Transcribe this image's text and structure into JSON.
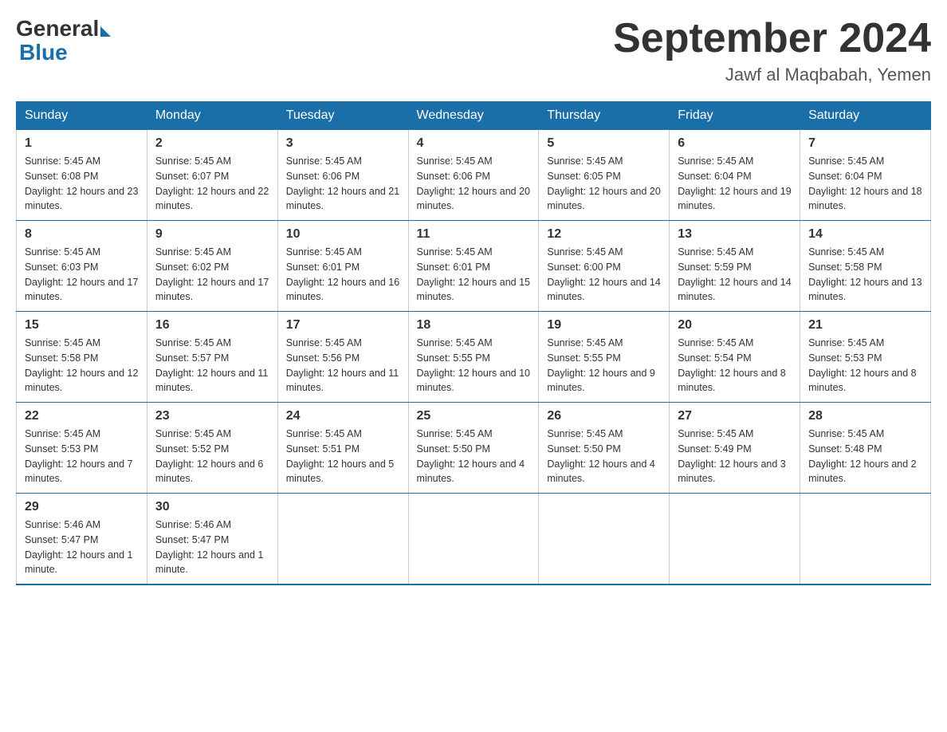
{
  "header": {
    "logo_general": "General",
    "logo_blue": "Blue",
    "month_title": "September 2024",
    "location": "Jawf al Maqbabah, Yemen"
  },
  "weekdays": [
    "Sunday",
    "Monday",
    "Tuesday",
    "Wednesday",
    "Thursday",
    "Friday",
    "Saturday"
  ],
  "weeks": [
    [
      {
        "day": "1",
        "sunrise": "5:45 AM",
        "sunset": "6:08 PM",
        "daylight": "12 hours and 23 minutes."
      },
      {
        "day": "2",
        "sunrise": "5:45 AM",
        "sunset": "6:07 PM",
        "daylight": "12 hours and 22 minutes."
      },
      {
        "day": "3",
        "sunrise": "5:45 AM",
        "sunset": "6:06 PM",
        "daylight": "12 hours and 21 minutes."
      },
      {
        "day": "4",
        "sunrise": "5:45 AM",
        "sunset": "6:06 PM",
        "daylight": "12 hours and 20 minutes."
      },
      {
        "day": "5",
        "sunrise": "5:45 AM",
        "sunset": "6:05 PM",
        "daylight": "12 hours and 20 minutes."
      },
      {
        "day": "6",
        "sunrise": "5:45 AM",
        "sunset": "6:04 PM",
        "daylight": "12 hours and 19 minutes."
      },
      {
        "day": "7",
        "sunrise": "5:45 AM",
        "sunset": "6:04 PM",
        "daylight": "12 hours and 18 minutes."
      }
    ],
    [
      {
        "day": "8",
        "sunrise": "5:45 AM",
        "sunset": "6:03 PM",
        "daylight": "12 hours and 17 minutes."
      },
      {
        "day": "9",
        "sunrise": "5:45 AM",
        "sunset": "6:02 PM",
        "daylight": "12 hours and 17 minutes."
      },
      {
        "day": "10",
        "sunrise": "5:45 AM",
        "sunset": "6:01 PM",
        "daylight": "12 hours and 16 minutes."
      },
      {
        "day": "11",
        "sunrise": "5:45 AM",
        "sunset": "6:01 PM",
        "daylight": "12 hours and 15 minutes."
      },
      {
        "day": "12",
        "sunrise": "5:45 AM",
        "sunset": "6:00 PM",
        "daylight": "12 hours and 14 minutes."
      },
      {
        "day": "13",
        "sunrise": "5:45 AM",
        "sunset": "5:59 PM",
        "daylight": "12 hours and 14 minutes."
      },
      {
        "day": "14",
        "sunrise": "5:45 AM",
        "sunset": "5:58 PM",
        "daylight": "12 hours and 13 minutes."
      }
    ],
    [
      {
        "day": "15",
        "sunrise": "5:45 AM",
        "sunset": "5:58 PM",
        "daylight": "12 hours and 12 minutes."
      },
      {
        "day": "16",
        "sunrise": "5:45 AM",
        "sunset": "5:57 PM",
        "daylight": "12 hours and 11 minutes."
      },
      {
        "day": "17",
        "sunrise": "5:45 AM",
        "sunset": "5:56 PM",
        "daylight": "12 hours and 11 minutes."
      },
      {
        "day": "18",
        "sunrise": "5:45 AM",
        "sunset": "5:55 PM",
        "daylight": "12 hours and 10 minutes."
      },
      {
        "day": "19",
        "sunrise": "5:45 AM",
        "sunset": "5:55 PM",
        "daylight": "12 hours and 9 minutes."
      },
      {
        "day": "20",
        "sunrise": "5:45 AM",
        "sunset": "5:54 PM",
        "daylight": "12 hours and 8 minutes."
      },
      {
        "day": "21",
        "sunrise": "5:45 AM",
        "sunset": "5:53 PM",
        "daylight": "12 hours and 8 minutes."
      }
    ],
    [
      {
        "day": "22",
        "sunrise": "5:45 AM",
        "sunset": "5:53 PM",
        "daylight": "12 hours and 7 minutes."
      },
      {
        "day": "23",
        "sunrise": "5:45 AM",
        "sunset": "5:52 PM",
        "daylight": "12 hours and 6 minutes."
      },
      {
        "day": "24",
        "sunrise": "5:45 AM",
        "sunset": "5:51 PM",
        "daylight": "12 hours and 5 minutes."
      },
      {
        "day": "25",
        "sunrise": "5:45 AM",
        "sunset": "5:50 PM",
        "daylight": "12 hours and 4 minutes."
      },
      {
        "day": "26",
        "sunrise": "5:45 AM",
        "sunset": "5:50 PM",
        "daylight": "12 hours and 4 minutes."
      },
      {
        "day": "27",
        "sunrise": "5:45 AM",
        "sunset": "5:49 PM",
        "daylight": "12 hours and 3 minutes."
      },
      {
        "day": "28",
        "sunrise": "5:45 AM",
        "sunset": "5:48 PM",
        "daylight": "12 hours and 2 minutes."
      }
    ],
    [
      {
        "day": "29",
        "sunrise": "5:46 AM",
        "sunset": "5:47 PM",
        "daylight": "12 hours and 1 minute."
      },
      {
        "day": "30",
        "sunrise": "5:46 AM",
        "sunset": "5:47 PM",
        "daylight": "12 hours and 1 minute."
      },
      null,
      null,
      null,
      null,
      null
    ]
  ]
}
